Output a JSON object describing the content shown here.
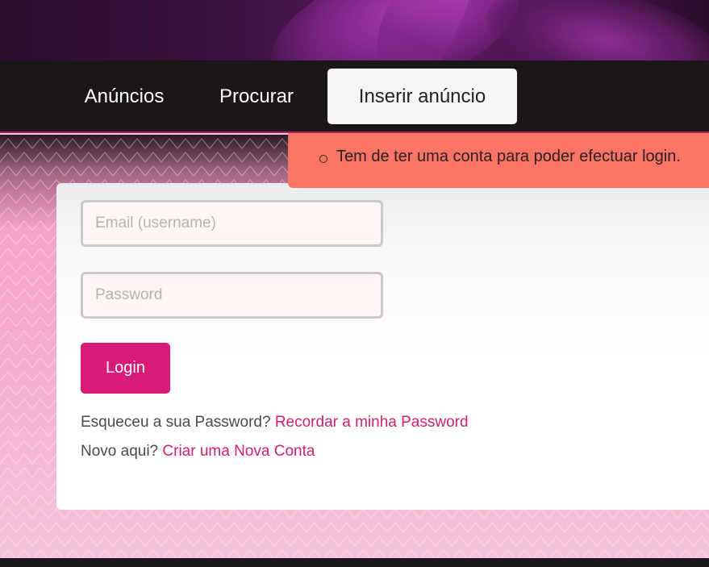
{
  "nav": {
    "items": [
      {
        "label": "Anúncios"
      },
      {
        "label": "Procurar"
      },
      {
        "label": "Inserir anúncio"
      }
    ],
    "active_index": 2
  },
  "alert": {
    "message": "Tem de ter uma conta para poder efectuar login."
  },
  "login_form": {
    "email_placeholder": "Email (username)",
    "email_value": "",
    "password_placeholder": "Password",
    "password_value": "",
    "login_label": "Login",
    "forgot_prefix": "Esqueceu a sua Password?",
    "forgot_link": "Recordar a minha Password",
    "new_prefix": "Novo aqui?",
    "new_link": "Criar uma Nova Conta"
  },
  "colors": {
    "brand": "#d81b79",
    "alert_bg": "#fb7566",
    "nav_bg": "#1b1618",
    "link": "#d11f72"
  }
}
